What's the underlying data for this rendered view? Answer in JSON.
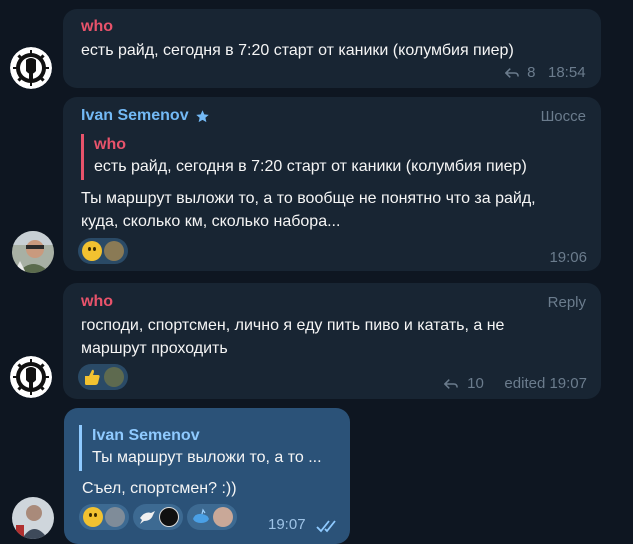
{
  "colors": {
    "background": "#0e1621",
    "bubble_in": "#182533",
    "bubble_out": "#2b5278",
    "name_red": "#e8536b",
    "name_blue": "#73b9f5",
    "meta": "#6b7c8d"
  },
  "messages": [
    {
      "sender": "who",
      "text_lines": [
        "есть райд, сегодня в 7:20 старт от каники (колумбия пиер)"
      ],
      "reply_count": "8",
      "time": "18:54"
    },
    {
      "sender": "Ivan Semenov",
      "tag": "Шоссе",
      "quote": {
        "sender": "who",
        "text": "есть райд, сегодня в 7:20 старт от каники (колумбия пиер)"
      },
      "text_lines": [
        "Ты маршрут выложи то, а то вообще не понятно что за райд,",
        "куда, сколько км, сколько набора..."
      ],
      "time": "19:06",
      "reactions": [
        "grinning-face-emoji",
        "user-avatar"
      ]
    },
    {
      "sender": "who",
      "tag": "Reply",
      "text_lines": [
        "господи, спортсмен, лично я еду пить пиво и катать, а не",
        "маршрут проходить"
      ],
      "reply_count": "10",
      "edited_time": "edited 19:07",
      "reactions": [
        "thumbs-up-emoji",
        "user-avatar"
      ]
    },
    {
      "quote": {
        "sender": "Ivan Semenov",
        "text": "Ты маршрут выложи то, а то ..."
      },
      "text": "Съел, спортсмен? :))",
      "time": "19:07",
      "reactions": [
        [
          "crying-face-emoji",
          "user-avatar"
        ],
        [
          "dove-emoji",
          "user-avatar"
        ],
        [
          "whale-emoji",
          "user-avatar"
        ]
      ]
    }
  ]
}
